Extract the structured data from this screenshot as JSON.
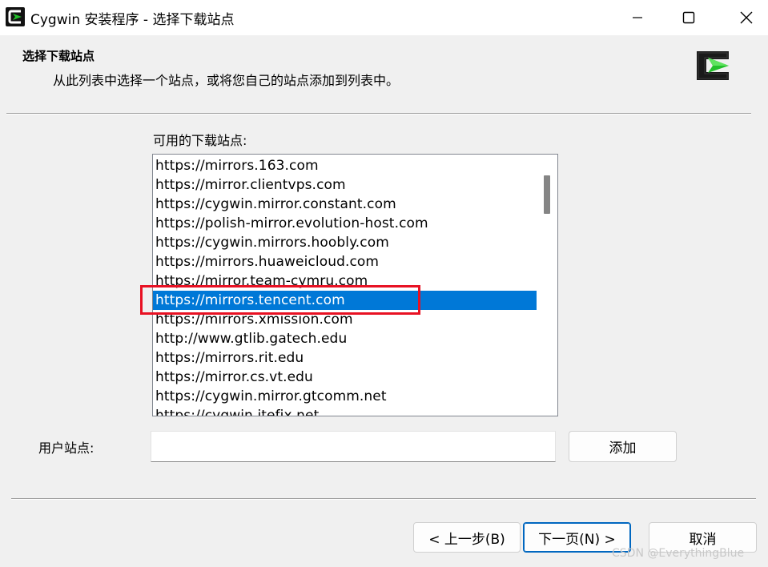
{
  "window": {
    "title": "Cygwin 安装程序 - 选择下载站点"
  },
  "header": {
    "title": "选择下载站点",
    "subtitle": "从此列表中选择一个站点，或将您自己的站点添加到列表中。"
  },
  "sites": {
    "label": "可用的下载站点:",
    "items": [
      "https://mirrors.163.com",
      "https://mirror.clientvps.com",
      "https://cygwin.mirror.constant.com",
      "https://polish-mirror.evolution-host.com",
      "https://cygwin.mirrors.hoobly.com",
      "https://mirrors.huaweicloud.com",
      "https://mirror.team-cymru.com",
      "https://mirrors.tencent.com",
      "https://mirrors.xmission.com",
      "http://www.gtlib.gatech.edu",
      "https://mirrors.rit.edu",
      "https://mirror.cs.vt.edu",
      "https://cygwin.mirror.gtcomm.net",
      "https://cygwin.itefix.net"
    ],
    "selected": "https://mirrors.tencent.com"
  },
  "user_site": {
    "label": "用户站点:",
    "value": "",
    "add_label": "添加"
  },
  "footer": {
    "back_label": "< 上一步(B)",
    "next_label": "下一页(N) >",
    "cancel_label": "取消"
  },
  "watermark": "CSDN @EverythingBlue",
  "colors": {
    "selection": "#0078d7",
    "highlight_box": "#e81123",
    "logo_green": "#22c02a"
  },
  "icons": [
    "cygwin-icon",
    "minimize-icon",
    "maximize-icon",
    "close-icon",
    "cygwin-logo"
  ]
}
